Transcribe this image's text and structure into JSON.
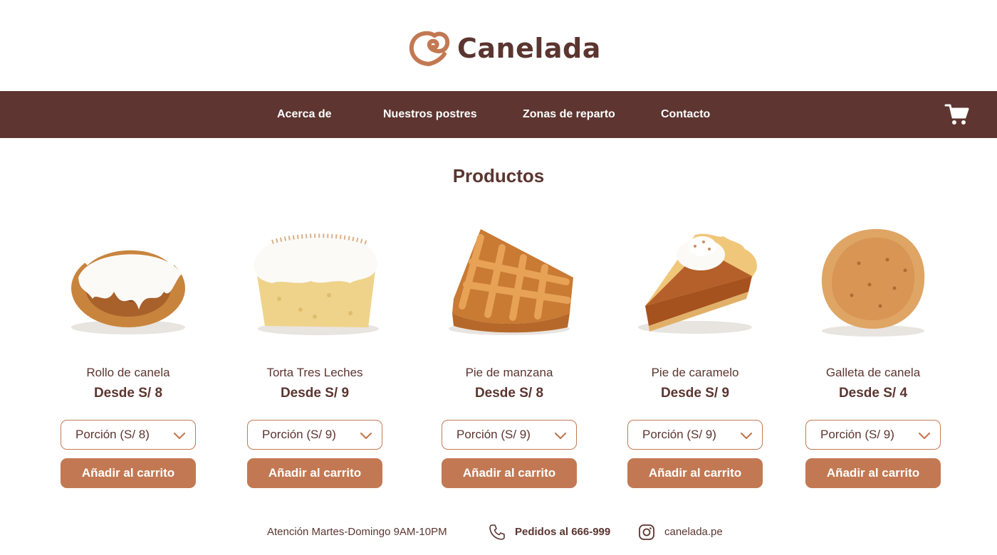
{
  "brand": {
    "name": "Canelada",
    "color": "#5b3530",
    "accent": "#c27953",
    "icon": "cinnamon-swirl-heart-icon"
  },
  "nav": {
    "background": "#5e3530",
    "items": [
      {
        "label": "Acerca de"
      },
      {
        "label": "Nuestros postres"
      },
      {
        "label": "Zonas de reparto"
      },
      {
        "label": "Contacto"
      }
    ],
    "cart_icon": "shopping-cart-icon"
  },
  "main": {
    "title": "Productos",
    "products": [
      {
        "name": "Rollo de canela",
        "price": "Desde S/ 8",
        "option": "Porción (S/ 8)",
        "button": "Añadir al carrito",
        "image": "cinnamon-roll"
      },
      {
        "name": "Torta Tres Leches",
        "price": "Desde S/ 9",
        "option": "Porción (S/ 9)",
        "button": "Añadir al carrito",
        "image": "tres-leches-cake"
      },
      {
        "name": "Pie de manzana",
        "price": "Desde S/ 8",
        "option": "Porción (S/ 9)",
        "button": "Añadir al carrito",
        "image": "apple-pie-slice"
      },
      {
        "name": "Pie de caramelo",
        "price": "Desde S/ 9",
        "option": "Porción (S/ 9)",
        "button": "Añadir al carrito",
        "image": "caramel-pie-slice"
      },
      {
        "name": "Galleta de canela",
        "price": "Desde S/ 4",
        "option": "Porción (S/ 9)",
        "button": "Añadir al carrito",
        "image": "cinnamon-cookie"
      }
    ]
  },
  "footer": {
    "hours": "Atención Martes-Domingo 9AM-10PM",
    "orders": "Pedidos al 666-999",
    "instagram": "canelada.pe",
    "phone_icon": "phone-icon",
    "instagram_icon": "instagram-icon"
  }
}
